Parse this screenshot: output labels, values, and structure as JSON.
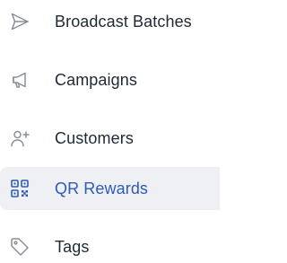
{
  "sidebar": {
    "items": [
      {
        "label": "Broadcast Batches",
        "icon": "send-icon",
        "active": false
      },
      {
        "label": "Campaigns",
        "icon": "megaphone-icon",
        "active": false
      },
      {
        "label": "Customers",
        "icon": "user-plus-icon",
        "active": false
      },
      {
        "label": "QR Rewards",
        "icon": "qr-code-icon",
        "active": true
      },
      {
        "label": "Tags",
        "icon": "tag-icon",
        "active": false
      }
    ]
  },
  "colors": {
    "text": "#1f2933",
    "icon": "#8a8f98",
    "active_text": "#2e5bb8",
    "active_background": "#eef0f4"
  }
}
